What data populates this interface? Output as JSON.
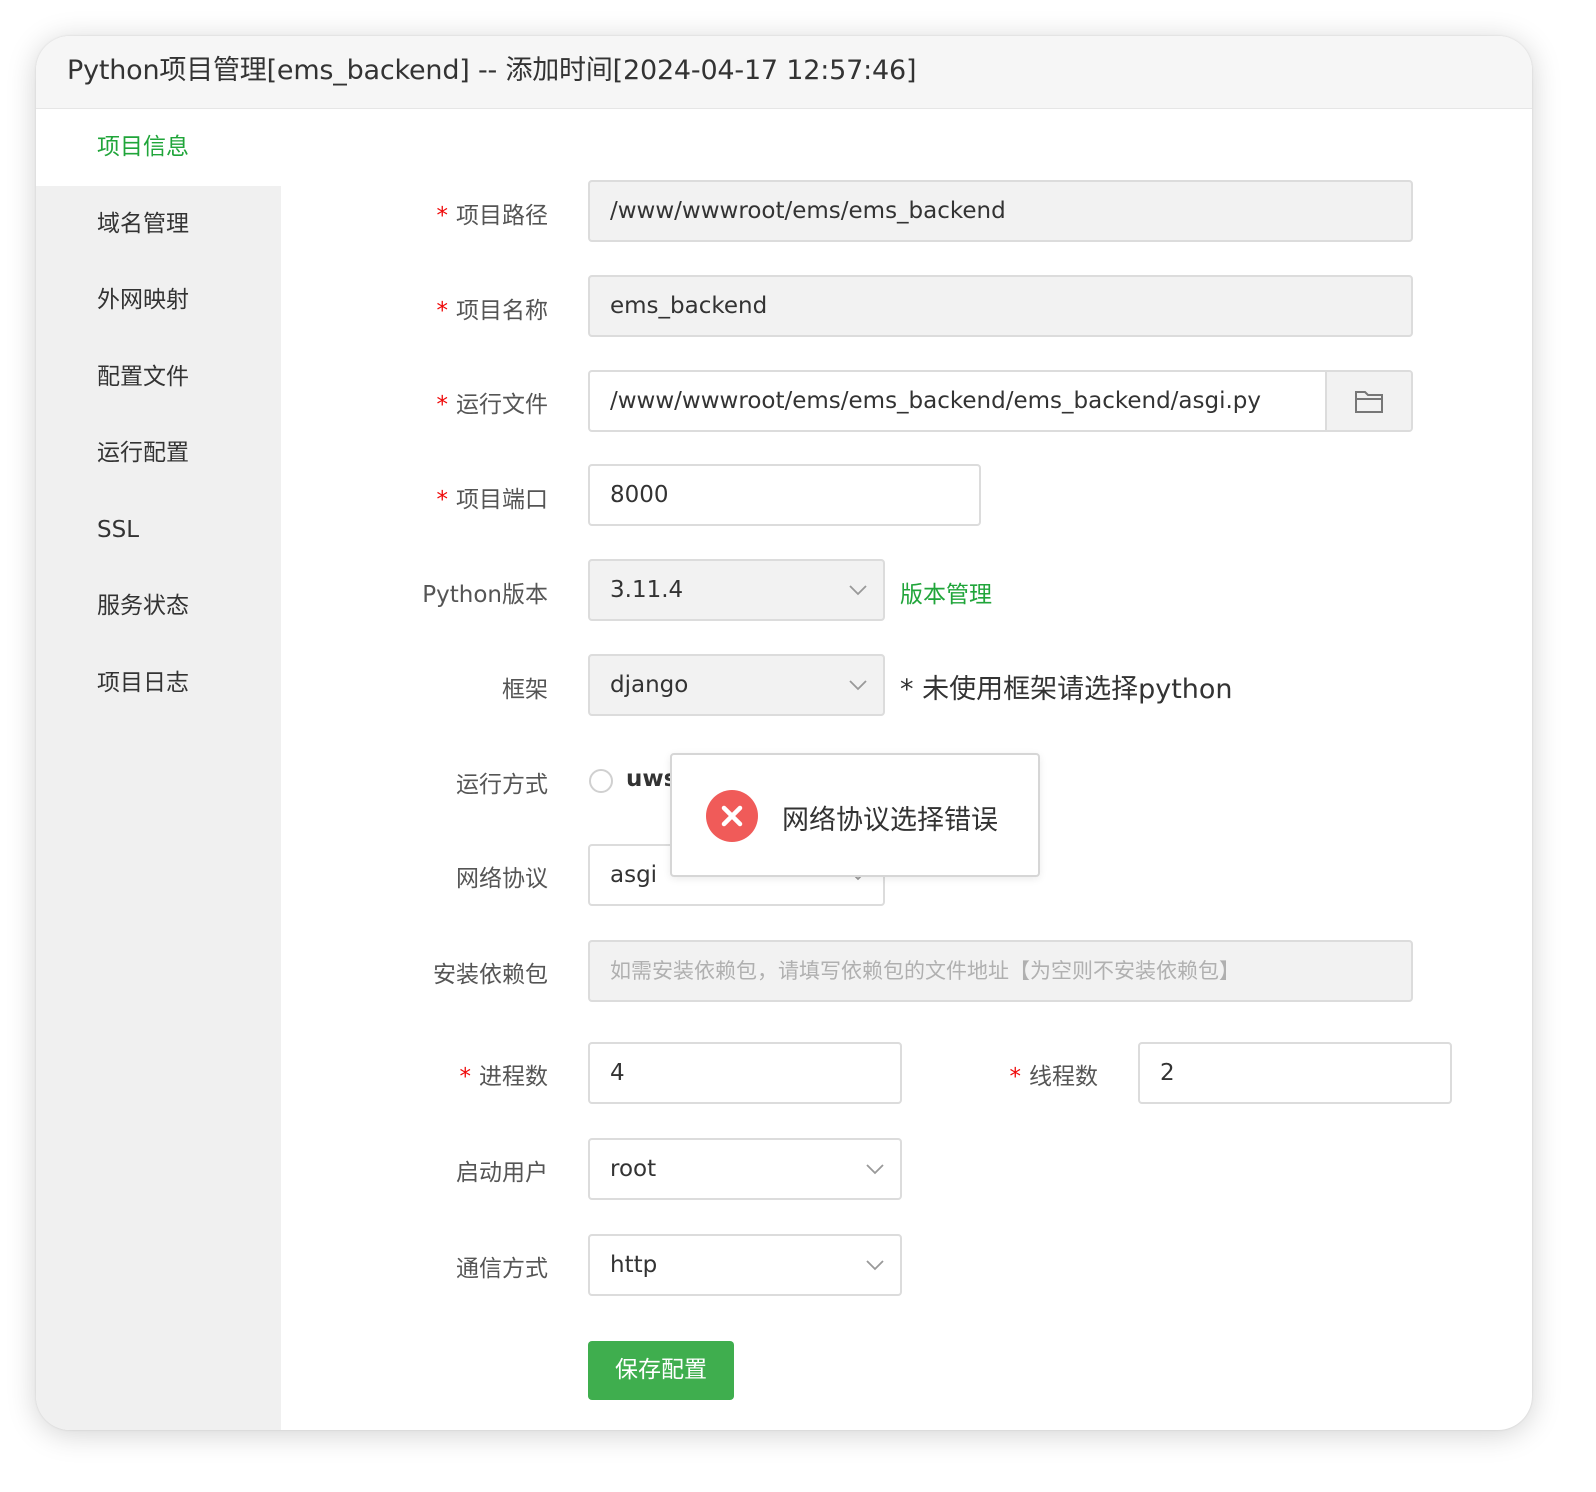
{
  "window": {
    "title": "Python项目管理[ems_backend] -- 添加时间[2024-04-17 12:57:46]"
  },
  "sidebar": {
    "items": [
      {
        "label": "项目信息",
        "active": true
      },
      {
        "label": "域名管理"
      },
      {
        "label": "外网映射"
      },
      {
        "label": "配置文件"
      },
      {
        "label": "运行配置"
      },
      {
        "label": "SSL"
      },
      {
        "label": "服务状态"
      },
      {
        "label": "项目日志"
      }
    ]
  },
  "form": {
    "required_mark": "*",
    "project_path": {
      "label": "项目路径",
      "value": "/www/wwwroot/ems/ems_backend"
    },
    "project_name": {
      "label": "项目名称",
      "value": "ems_backend"
    },
    "run_file": {
      "label": "运行文件",
      "value": "/www/wwwroot/ems/ems_backend/ems_backend/asgi.py",
      "button_icon": "folder-icon"
    },
    "project_port": {
      "label": "项目端口",
      "value": "8000"
    },
    "python_version": {
      "label": "Python版本",
      "value": "3.11.4",
      "link": "版本管理"
    },
    "framework": {
      "label": "框架",
      "value": "django",
      "hint": "* 未使用框架请选择python"
    },
    "run_mode": {
      "label": "运行方式",
      "option_visible": "uws"
    },
    "network_protocol": {
      "label": "网络协议",
      "value": "asgi"
    },
    "install_deps": {
      "label": "安装依赖包",
      "placeholder": "如需安装依赖包，请填写依赖包的文件地址【为空则不安装依赖包】"
    },
    "processes": {
      "label": "进程数",
      "value": "4"
    },
    "threads": {
      "label": "线程数",
      "value": "2"
    },
    "start_user": {
      "label": "启动用户",
      "value": "root"
    },
    "communication": {
      "label": "通信方式",
      "value": "http"
    },
    "save_button": "保存配置"
  },
  "toast": {
    "message": "网络协议选择错误",
    "icon": "error-x-icon",
    "color": "#f05b59"
  },
  "colors": {
    "accent": "#20a53a",
    "button": "#3fae4e",
    "required": "#ef0808"
  }
}
